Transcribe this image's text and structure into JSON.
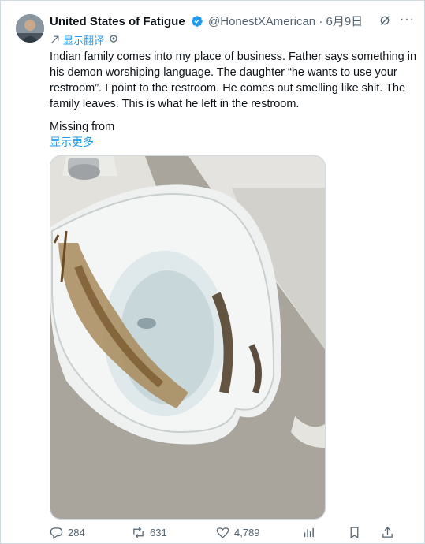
{
  "tweet": {
    "author_name": "United States of Fatigue",
    "handle": "@HonestXAmerican",
    "separator": "·",
    "date": "6月9日",
    "translate_label": "显示翻译",
    "text": "Indian family comes into my place of business. Father says something in his demon worshiping language. The daughter “he wants to use your restroom”. I point to the restroom. He comes out smelling like shit. The family leaves. This is what he left in the restroom.",
    "missing_label": "Missing from",
    "show_more_label": "显示更多"
  },
  "actions": {
    "replies": "284",
    "reposts": "631",
    "likes": "4,789"
  },
  "colors": {
    "accent": "#1d9bf0",
    "secondary_text": "#536471"
  }
}
